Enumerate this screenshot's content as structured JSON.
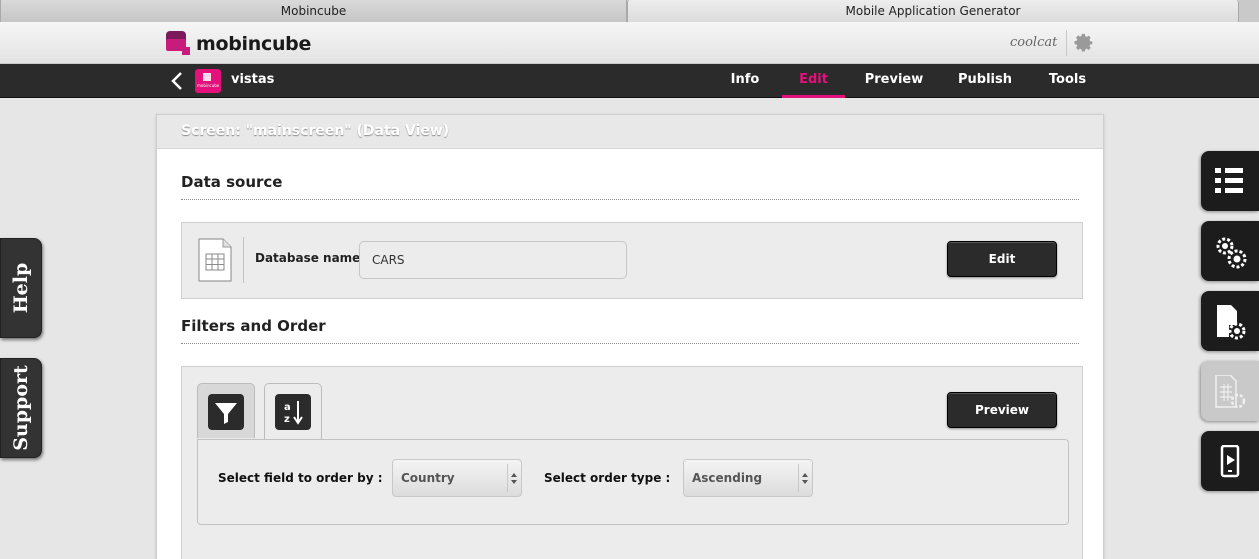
{
  "browser": {
    "tabs": [
      "Mobincube",
      "Mobile Application Generator"
    ]
  },
  "header": {
    "brand": "mobincube",
    "username": "coolcat"
  },
  "nav": {
    "app_name": "vistas",
    "app_icon_text": "mobincube",
    "items": [
      "Info",
      "Edit",
      "Preview",
      "Publish",
      "Tools"
    ],
    "active": "Edit"
  },
  "side_tabs": {
    "help": "Help",
    "support": "Support"
  },
  "card": {
    "title": "Screen: \"mainscreen\" (Data View)",
    "data_source": {
      "section_title": "Data source",
      "db_label": "Database name",
      "db_value": "CARS",
      "edit_button": "Edit"
    },
    "filters": {
      "section_title": "Filters and Order",
      "preview_button": "Preview",
      "order_field_label": "Select field to order by :",
      "order_field_value": "Country",
      "order_type_label": "Select order type :",
      "order_type_value": "Ascending"
    }
  },
  "right_panel": {
    "buttons": [
      "list-icon",
      "gears-icon",
      "page-settings-icon",
      "database-settings-icon",
      "mobile-preview-icon"
    ]
  },
  "colors": {
    "accent": "#e4107c",
    "navbar": "#2b2b2b"
  }
}
